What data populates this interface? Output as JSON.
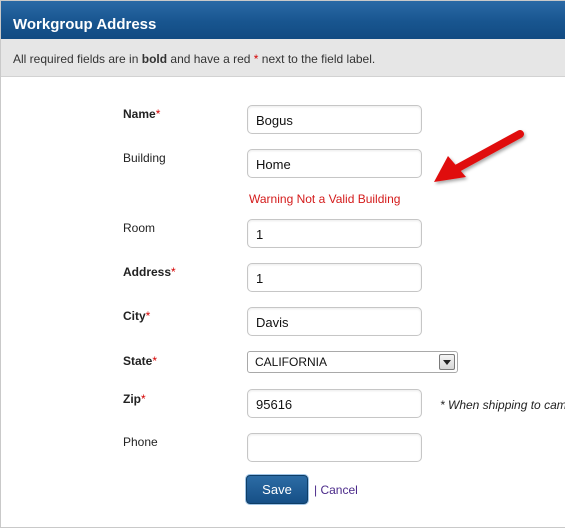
{
  "header": {
    "title": "Workgroup Address"
  },
  "info": {
    "prefix": "All required fields are in ",
    "bold": "bold",
    "middle": " and have a red ",
    "star": "*",
    "suffix": " next to the field label."
  },
  "form": {
    "name": {
      "label": "Name",
      "star": "*",
      "value": "Bogus"
    },
    "building": {
      "label": "Building",
      "value": "Home",
      "warning": "Warning Not a Valid Building"
    },
    "room": {
      "label": "Room",
      "value": "1"
    },
    "address": {
      "label": "Address",
      "star": "*",
      "value": "1"
    },
    "city": {
      "label": "City",
      "star": "*",
      "value": "Davis"
    },
    "state": {
      "label": "State",
      "star": "*",
      "value": "CALIFORNIA"
    },
    "zip": {
      "label": "Zip",
      "star": "*",
      "value": "95616",
      "hint": "* When shipping to cam"
    },
    "phone": {
      "label": "Phone",
      "value": ""
    }
  },
  "actions": {
    "save_label": "Save",
    "separator": "|",
    "cancel_label": "Cancel"
  },
  "colors": {
    "header_bg": "#18558f",
    "required_star": "#d40000",
    "warning_text": "#d41b1b",
    "annotation_arrow": "#e01010",
    "link": "#4b2a8a"
  },
  "icons": {
    "select_arrow": "chevron-down-icon",
    "annotation": "red-arrow-icon"
  }
}
